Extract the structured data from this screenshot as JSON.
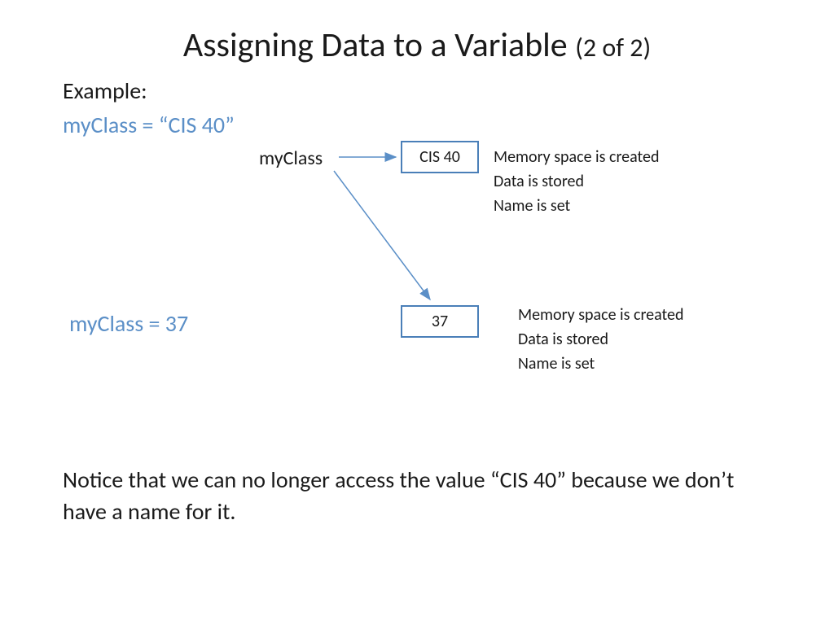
{
  "title": {
    "main": "Assigning Data to a Variable",
    "sub": "(2 of 2)"
  },
  "example_label": "Example:",
  "code1": "myClass = “CIS 40”",
  "var_label": "myClass",
  "box1_value": "CIS 40",
  "notes1": {
    "line1": "Memory space is created",
    "line2": "Data is stored",
    "line3": "Name is set"
  },
  "code2": "myClass = 37",
  "box2_value": "37",
  "notes2": {
    "line1": "Memory space is created",
    "line2": "Data is stored",
    "line3": "Name is set"
  },
  "footer": "Notice that we can no longer access the value “CIS 40” because we don’t have a name for it."
}
